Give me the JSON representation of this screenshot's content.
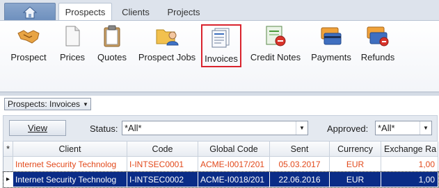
{
  "tabs": [
    {
      "label": "Prospects",
      "active": true
    },
    {
      "label": "Clients",
      "active": false
    },
    {
      "label": "Projects",
      "active": false
    }
  ],
  "ribbon": {
    "buttons": [
      {
        "label": "Prospect",
        "icon": "handshake-icon"
      },
      {
        "label": "Prices",
        "icon": "document-icon"
      },
      {
        "label": "Quotes",
        "icon": "clipboard-icon"
      },
      {
        "label": "Prospect Jobs",
        "icon": "folder-user-icon"
      },
      {
        "label": "Invoices",
        "icon": "invoice-list-icon",
        "highlighted": true
      },
      {
        "label": "Credit Notes",
        "icon": "credit-note-icon"
      },
      {
        "label": "Payments",
        "icon": "payment-cards-icon"
      },
      {
        "label": "Refunds",
        "icon": "refund-cards-icon"
      }
    ]
  },
  "context": {
    "label": "Prospects: Invoices"
  },
  "filter": {
    "view_label": "View",
    "status_label": "Status:",
    "status_value": "*All*",
    "approved_label": "Approved:",
    "approved_value": "*All*"
  },
  "grid": {
    "corner": "*",
    "columns": [
      "Client",
      "Code",
      "Global Code",
      "Sent",
      "Currency",
      "Exchange Ra"
    ],
    "rows": [
      {
        "marker": "",
        "client": "Internet Security Technolog",
        "code": "I-INTSEC0001",
        "global_code": "ACME-I0017/201",
        "sent": "05.03.2017",
        "currency": "EUR",
        "rate": "1,00"
      },
      {
        "marker": "▸",
        "client": "Internet Security Technolog",
        "code": "I-INTSEC0002",
        "global_code": "ACME-I0018/201",
        "sent": "22.06.2016",
        "currency": "EUR",
        "rate": "1,00"
      }
    ]
  },
  "colors": {
    "accent": "#0a2c87",
    "highlight_border": "#d9232d",
    "row_text": "#e2491b"
  }
}
